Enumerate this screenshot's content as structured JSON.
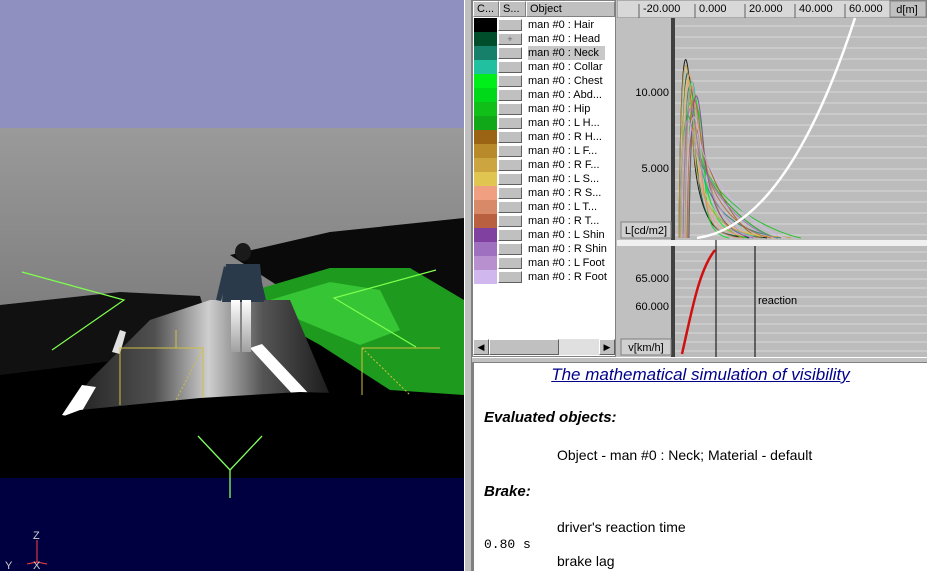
{
  "objects_panel": {
    "columns": {
      "color": "C...",
      "state": "S...",
      "object": "Object"
    },
    "selected_index": 2,
    "items": [
      {
        "name": "man #0 : Hair",
        "color": "#000000",
        "state": ""
      },
      {
        "name": "man #0 : Head",
        "color": "#004d2c",
        "state": "+"
      },
      {
        "name": "man #0 : Neck",
        "color": "#16806a",
        "state": ""
      },
      {
        "name": "man #0 : Collar",
        "color": "#20c0a0",
        "state": ""
      },
      {
        "name": "man #0 : Chest",
        "color": "#00ee1a",
        "state": ""
      },
      {
        "name": "man #0 : Abd...",
        "color": "#00d81a",
        "state": ""
      },
      {
        "name": "man #0 : Hip",
        "color": "#10c018",
        "state": ""
      },
      {
        "name": "man #0 : L H...",
        "color": "#10a818",
        "state": ""
      },
      {
        "name": "man #0 : R H...",
        "color": "#9a6414",
        "state": ""
      },
      {
        "name": "man #0 : L F...",
        "color": "#b88a2a",
        "state": ""
      },
      {
        "name": "man #0 : R F...",
        "color": "#cca440",
        "state": ""
      },
      {
        "name": "man #0 : L S...",
        "color": "#e0c650",
        "state": ""
      },
      {
        "name": "man #0 : R S...",
        "color": "#f0a080",
        "state": ""
      },
      {
        "name": "man #0 : L T...",
        "color": "#d88a68",
        "state": ""
      },
      {
        "name": "man #0 : R T...",
        "color": "#b86040",
        "state": ""
      },
      {
        "name": "man #0 : L Shin",
        "color": "#8040a0",
        "state": ""
      },
      {
        "name": "man #0 : R Shin",
        "color": "#a070c0",
        "state": ""
      },
      {
        "name": "man #0 : L Foot",
        "color": "#b890d0",
        "state": ""
      },
      {
        "name": "man #0 : R Foot",
        "color": "#d0b8ee",
        "state": ""
      }
    ]
  },
  "chart_data": {
    "type": "line",
    "x_ticks": [
      "-20.000",
      "0.000",
      "20.000",
      "40.000",
      "60.000"
    ],
    "x_unit": "d[m]",
    "top": {
      "ylabel": "L[cd/m2]",
      "y_ticks": [
        "10.000",
        "5.000"
      ]
    },
    "bottom": {
      "ylabel": "v[km/h]",
      "y_ticks": [
        "65.000",
        "60.000"
      ],
      "annotation": "reaction"
    }
  },
  "report": {
    "title": "The mathematical simulation of visibility",
    "section_objects": "Evaluated objects:",
    "objects_line": "Object - man #0 : Neck; Material - default",
    "section_brake": "Brake:",
    "reaction_label": "driver's reaction time",
    "reaction_value": "0.80 s",
    "lag_label": "brake lag"
  },
  "axes_gizmo": {
    "z": "Z",
    "y": "Y",
    "x": "X"
  }
}
